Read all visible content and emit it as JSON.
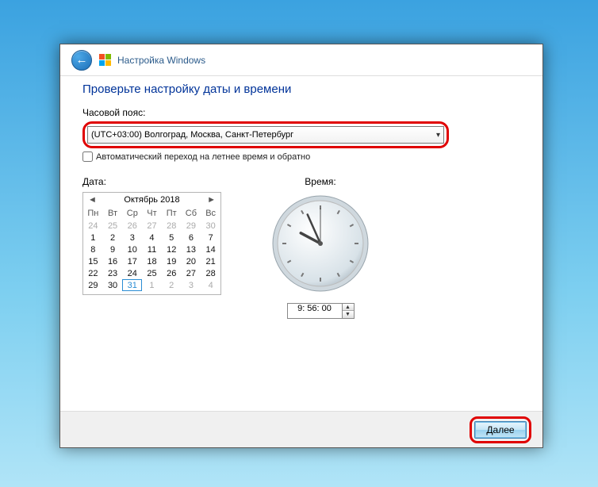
{
  "window": {
    "title": "Настройка Windows"
  },
  "heading": "Проверьте настройку даты и времени",
  "timezone": {
    "label": "Часовой пояс:",
    "selected": "(UTC+03:00) Волгоград, Москва, Санкт-Петербург"
  },
  "dst": {
    "label": "Автоматический переход на летнее время и обратно",
    "checked": false
  },
  "date": {
    "label": "Дата:",
    "month_title": "Октябрь 2018",
    "dow": [
      "Пн",
      "Вт",
      "Ср",
      "Чт",
      "Пт",
      "Сб",
      "Вс"
    ],
    "cells": [
      {
        "n": "24",
        "other": true
      },
      {
        "n": "25",
        "other": true
      },
      {
        "n": "26",
        "other": true
      },
      {
        "n": "27",
        "other": true
      },
      {
        "n": "28",
        "other": true
      },
      {
        "n": "29",
        "other": true
      },
      {
        "n": "30",
        "other": true
      },
      {
        "n": "1"
      },
      {
        "n": "2"
      },
      {
        "n": "3"
      },
      {
        "n": "4"
      },
      {
        "n": "5"
      },
      {
        "n": "6"
      },
      {
        "n": "7"
      },
      {
        "n": "8"
      },
      {
        "n": "9"
      },
      {
        "n": "10"
      },
      {
        "n": "11"
      },
      {
        "n": "12"
      },
      {
        "n": "13"
      },
      {
        "n": "14"
      },
      {
        "n": "15"
      },
      {
        "n": "16"
      },
      {
        "n": "17"
      },
      {
        "n": "18"
      },
      {
        "n": "19"
      },
      {
        "n": "20"
      },
      {
        "n": "21"
      },
      {
        "n": "22"
      },
      {
        "n": "23"
      },
      {
        "n": "24"
      },
      {
        "n": "25"
      },
      {
        "n": "26"
      },
      {
        "n": "27"
      },
      {
        "n": "28"
      },
      {
        "n": "29"
      },
      {
        "n": "30"
      },
      {
        "n": "31",
        "today": true
      },
      {
        "n": "1",
        "other": true
      },
      {
        "n": "2",
        "other": true
      },
      {
        "n": "3",
        "other": true
      },
      {
        "n": "4",
        "other": true
      }
    ]
  },
  "time": {
    "label": "Время:",
    "value": "9: 56: 00",
    "hour": 9,
    "minute": 56,
    "second": 0
  },
  "footer": {
    "next": "Далее"
  }
}
